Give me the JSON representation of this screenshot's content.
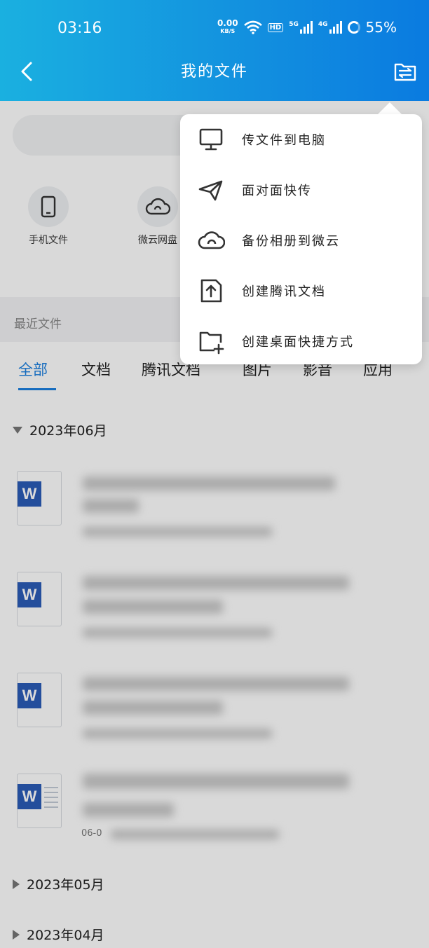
{
  "status_bar": {
    "time": "03:16",
    "net_speed_value": "0.00",
    "net_speed_unit": "KB/S",
    "hd_label": "HD",
    "sig1_label": "5G",
    "sig2_label": "4G",
    "battery": "55%"
  },
  "header": {
    "title": "我的文件"
  },
  "quick_access": [
    {
      "label": "手机文件",
      "icon": "phone-icon"
    },
    {
      "label": "微云网盘",
      "icon": "cloud-icon"
    }
  ],
  "recent": {
    "label": "最近文件"
  },
  "tabs": [
    "全部",
    "文档",
    "腾讯文档",
    "图片",
    "影音",
    "应用"
  ],
  "groups": [
    {
      "month": "2023年06月",
      "expanded": true
    },
    {
      "month": "2023年05月",
      "expanded": false
    },
    {
      "month": "2023年04月",
      "expanded": false
    }
  ],
  "files": [
    {
      "icon": "word-doc-icon"
    },
    {
      "icon": "word-doc-icon"
    },
    {
      "icon": "word-doc-icon"
    },
    {
      "icon": "word-doc-icon",
      "date_prefix": "06-0"
    }
  ],
  "menu": {
    "items": [
      {
        "label": "传文件到电脑",
        "icon": "monitor-icon"
      },
      {
        "label": "面对面快传",
        "icon": "paper-plane-icon"
      },
      {
        "label": "备份相册到微云",
        "icon": "cloud-icon"
      },
      {
        "label": "创建腾讯文档",
        "icon": "tencent-doc-icon"
      },
      {
        "label": "创建桌面快捷方式",
        "icon": "folder-add-icon"
      }
    ]
  },
  "colors": {
    "header_start": "#1ab0e0",
    "header_end": "#0a7be0",
    "accent": "#1b7fe0",
    "word_blue": "#2b5cb8"
  }
}
